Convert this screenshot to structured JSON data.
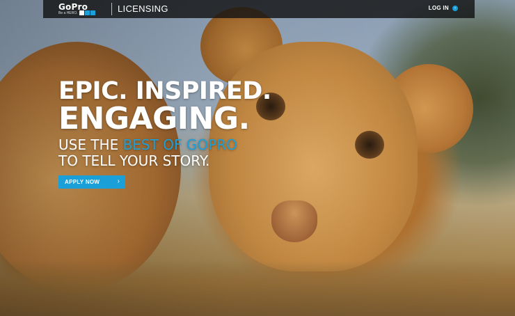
{
  "header": {
    "logo_text": "GoPro",
    "logo_tagline": "Be a HERO.",
    "section": "LICENSING",
    "login_label": "LOG IN",
    "login_icon": "arrow-circle-icon"
  },
  "hero": {
    "line1": "EPIC. INSPIRED.",
    "line2": "ENGAGING.",
    "sub_prefix": "USE THE ",
    "sub_accent": "BEST OF GOPRO",
    "sub_line2": "TO TELL YOUR STORY.",
    "cta_label": "APPLY NOW",
    "cta_icon": "chevron-right-icon"
  },
  "colors": {
    "accent": "#1a9fd9",
    "bar": "#141414"
  }
}
